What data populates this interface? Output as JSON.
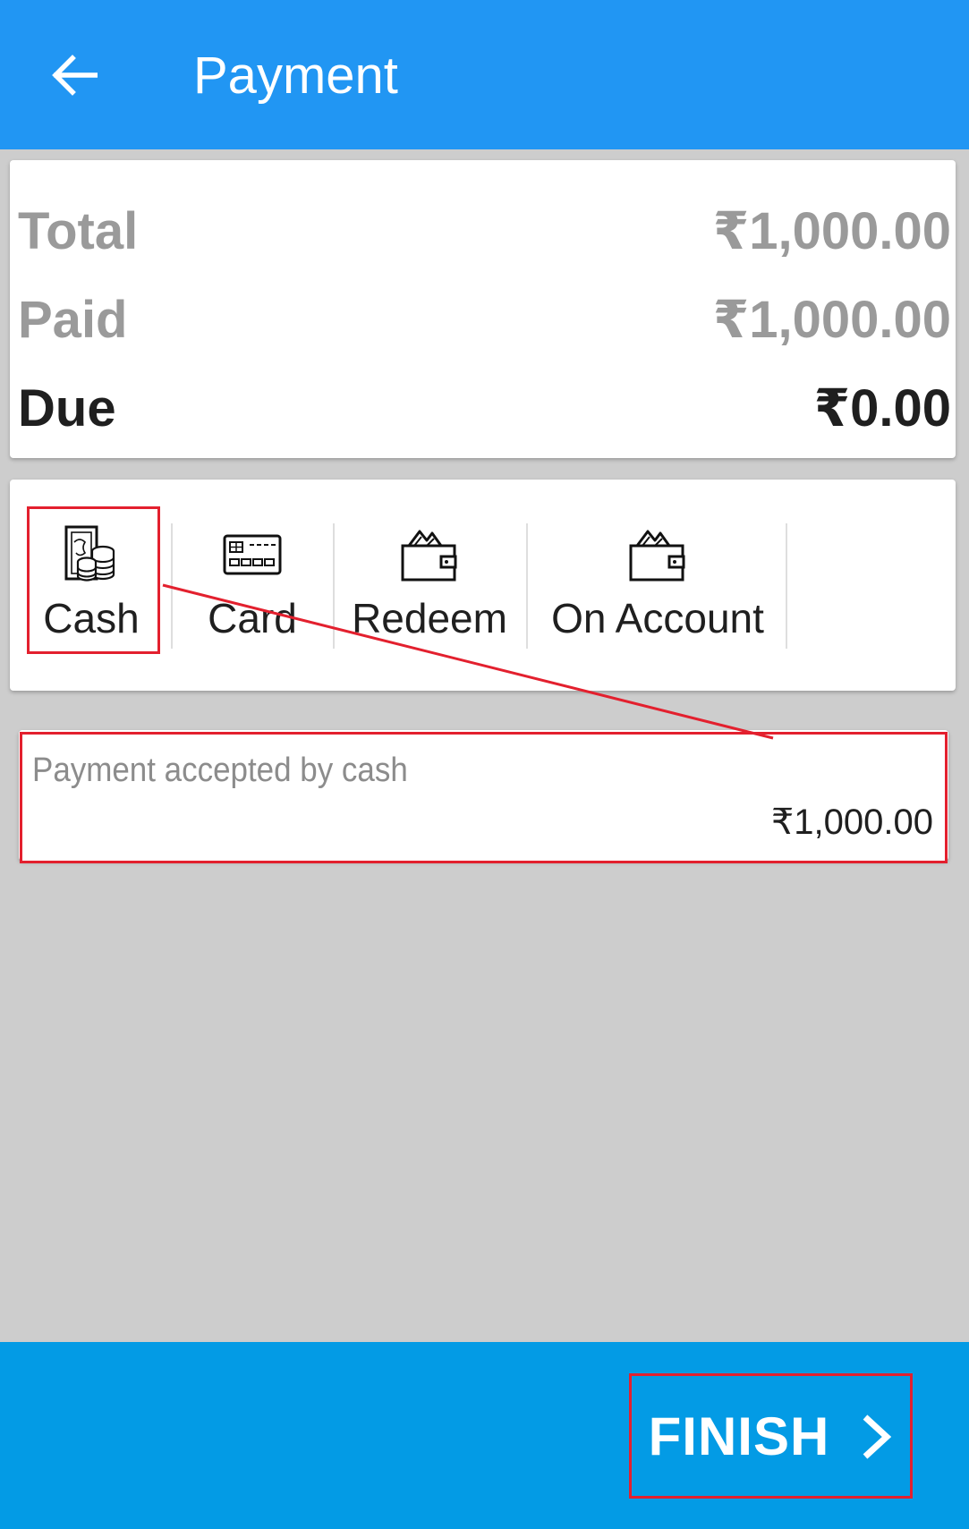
{
  "header": {
    "title": "Payment",
    "back_icon": "arrow-left-icon",
    "color": "#2196f3"
  },
  "summary": {
    "total_label": "Total",
    "total_value": "₹1,000.00",
    "paid_label": "Paid",
    "paid_value": "₹1,000.00",
    "due_label": "Due",
    "due_value": "₹0.00"
  },
  "payment_methods": [
    {
      "label": "Cash",
      "icon": "cash-icon",
      "selected": true
    },
    {
      "label": "Card",
      "icon": "credit-card-icon"
    },
    {
      "label": "Redeem",
      "icon": "wallet-icon"
    },
    {
      "label": "On Account",
      "icon": "wallet-icon"
    }
  ],
  "payment_entry": {
    "label": "Payment accepted by cash",
    "amount": "₹1,000.00"
  },
  "footer": {
    "finish_label": "FINISH",
    "finish_icon": "chevron-right-icon",
    "color": "#039be5"
  },
  "annotation_color": "#e3202e"
}
